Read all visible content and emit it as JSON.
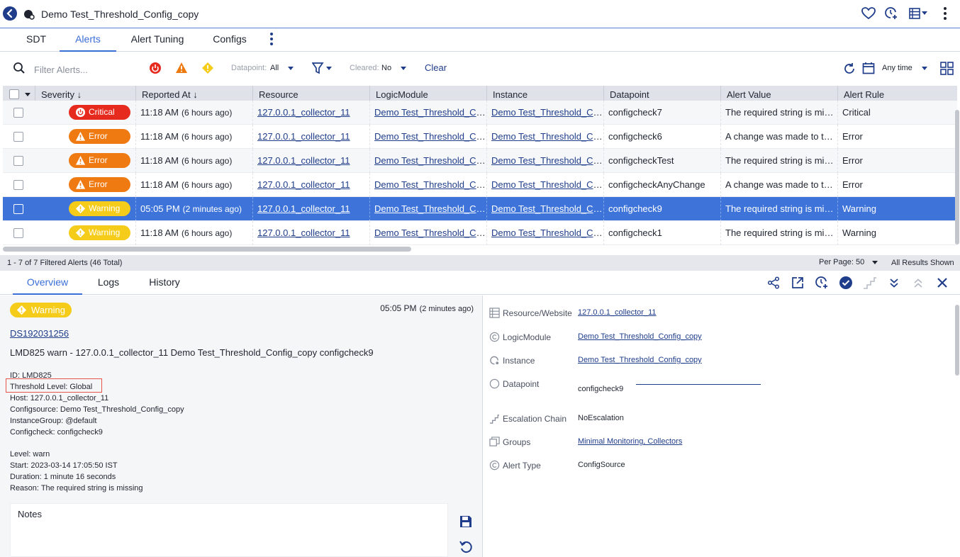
{
  "window": {
    "title": "Demo Test_Threshold_Config_copy"
  },
  "tabs": [
    {
      "label": "SDT"
    },
    {
      "label": "Alerts"
    },
    {
      "label": "Alert Tuning"
    },
    {
      "label": "Configs"
    }
  ],
  "filters": {
    "search_placeholder": "Filter Alerts...",
    "datapoint_label": "Datapoint:",
    "datapoint_value": "All",
    "cleared_label": "Cleared:",
    "cleared_value": "No",
    "clear_label": "Clear",
    "time_range": "Any time"
  },
  "table": {
    "columns": [
      "Severity",
      "Reported At",
      "Resource",
      "LogicModule",
      "Instance",
      "Datapoint",
      "Alert Value",
      "Alert Rule"
    ],
    "rows": [
      {
        "severity": "Critical",
        "time": "11:18 AM",
        "ago": "(6 hours ago)",
        "resource": "127.0.0.1_collector_11",
        "logic_module": "Demo Test_Threshold_Config_copy",
        "instance": "Demo Test_Threshold_Config_copy",
        "datapoint": "configcheck7",
        "alert_value": "The required string is missing",
        "alert_rule": "Critical"
      },
      {
        "severity": "Error",
        "time": "11:18 AM",
        "ago": "(6 hours ago)",
        "resource": "127.0.0.1_collector_11",
        "logic_module": "Demo Test_Threshold_Config_copy",
        "instance": "Demo Test_Threshold_Config_copy",
        "datapoint": "configcheck6",
        "alert_value": "A change was made to the file",
        "alert_rule": "Error"
      },
      {
        "severity": "Error",
        "time": "11:18 AM",
        "ago": "(6 hours ago)",
        "resource": "127.0.0.1_collector_11",
        "logic_module": "Demo Test_Threshold_Config_copy",
        "instance": "Demo Test_Threshold_Config_copy",
        "datapoint": "configcheckTest",
        "alert_value": "The required string is missing",
        "alert_rule": "Error"
      },
      {
        "severity": "Error",
        "time": "11:18 AM",
        "ago": "(6 hours ago)",
        "resource": "127.0.0.1_collector_11",
        "logic_module": "Demo Test_Threshold_Config_copy",
        "instance": "Demo Test_Threshold_Config_copy",
        "datapoint": "configcheckAnyChange",
        "alert_value": "A change was made to the file",
        "alert_rule": "Error"
      },
      {
        "severity": "Warning",
        "time": "05:05 PM",
        "ago": "(2 minutes ago)",
        "resource": "127.0.0.1_collector_11",
        "logic_module": "Demo Test_Threshold_Config_copy",
        "instance": "Demo Test_Threshold_Config_copy",
        "datapoint": "configcheck9",
        "alert_value": "The required string is missing",
        "alert_rule": "Warning"
      },
      {
        "severity": "Warning",
        "time": "11:18 AM",
        "ago": "(6 hours ago)",
        "resource": "127.0.0.1_collector_11",
        "logic_module": "Demo Test_Threshold_Config_copy",
        "instance": "Demo Test_Threshold_Config_copy",
        "datapoint": "configcheck1",
        "alert_value": "The required string is missing",
        "alert_rule": "Warning"
      }
    ],
    "selected_row": 4
  },
  "footer": {
    "count_text": "1 - 7 of 7 Filtered Alerts (46 Total)",
    "per_page_label": "Per Page:",
    "per_page_value": "50",
    "results_text": "All Results Shown"
  },
  "detail_tabs": [
    {
      "label": "Overview"
    },
    {
      "label": "Logs"
    },
    {
      "label": "History"
    }
  ],
  "detail": {
    "severity": "Warning",
    "time": "05:05 PM",
    "ago": "(2 minutes ago)",
    "ds_link": "DS192031256",
    "summary": "LMD825 warn - 127.0.0.1_collector_11 Demo Test_Threshold_Config_copy configcheck9",
    "lines_a": [
      "ID: LMD825",
      "Threshold Level: Global",
      "Host: 127.0.0.1_collector_11",
      "Configsource: Demo Test_Threshold_Config_copy",
      "InstanceGroup: @default",
      "Configcheck: configcheck9"
    ],
    "lines_b": [
      "Level: warn",
      "Start: 2023-03-14 17:05:50 IST",
      "Duration: 1 minute 16 seconds",
      "Reason: The required string is missing"
    ],
    "notes_label": "Notes"
  },
  "properties": [
    {
      "key": "Resource/Website",
      "value": "127.0.0.1_collector_11",
      "link": true
    },
    {
      "key": "LogicModule",
      "value": "Demo Test_Threshold_Config_copy",
      "link": true
    },
    {
      "key": "Instance",
      "value": "Demo Test_Threshold_Config_copy",
      "link": true
    },
    {
      "key": "Datapoint",
      "value": "configcheck9",
      "link": false
    },
    {
      "key": "Escalation Chain",
      "value": "NoEscalation",
      "link": false
    },
    {
      "key": "Groups",
      "value": "Minimal Monitoring, Collectors",
      "link": true
    },
    {
      "key": "Alert Type",
      "value": "ConfigSource",
      "link": false
    }
  ],
  "colors": {
    "accent": "#3a6fd8",
    "brand": "#1f3d8a",
    "critical": "#e62b1e",
    "error": "#f07a12",
    "warning": "#f5cc1a",
    "selected_row": "#3e74da"
  }
}
